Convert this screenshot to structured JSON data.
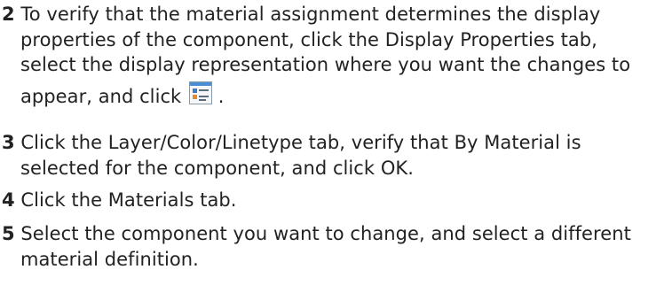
{
  "steps": [
    {
      "number": "2",
      "lines": [
        "To verify that the material assignment determines the display",
        "properties of the component, click the Display Properties tab,",
        "select the display representation where you want the changes to"
      ],
      "tail_before_icon": "appear, and click",
      "tail_after_icon": " .",
      "icon": "display-properties-edit-icon"
    },
    {
      "number": "3",
      "lines": [
        "Click the Layer/Color/Linetype tab, verify that By Material is",
        "selected for the component, and click OK."
      ]
    },
    {
      "number": "4",
      "lines": [
        "Click the Materials tab."
      ]
    },
    {
      "number": "5",
      "lines": [
        "Select the component you want to change, and select a different",
        "material definition."
      ]
    }
  ]
}
